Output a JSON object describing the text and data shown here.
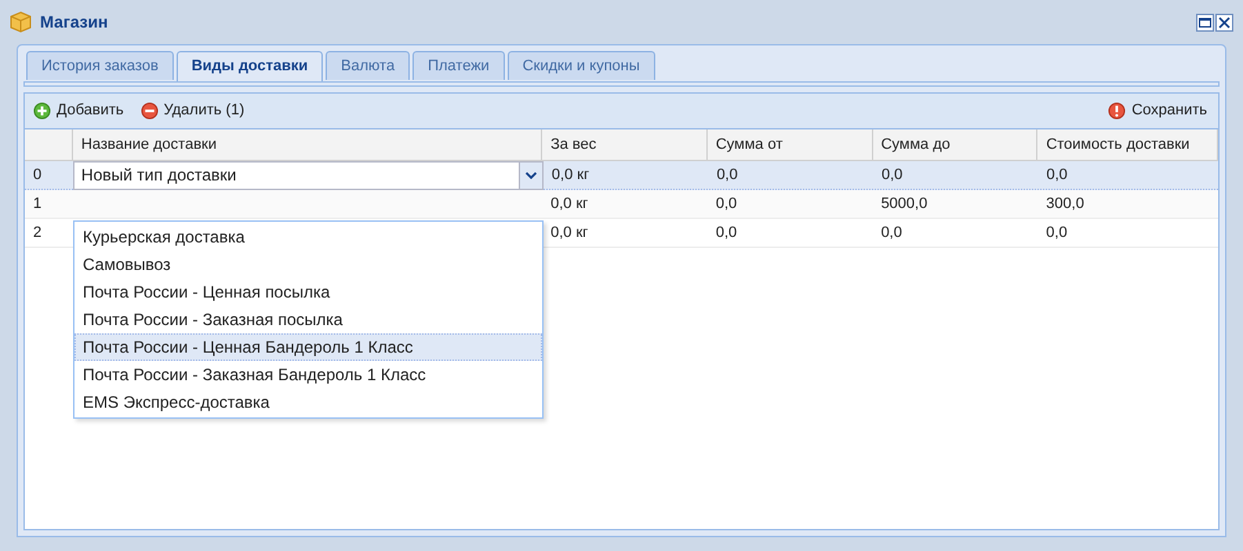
{
  "window": {
    "title": "Магазин"
  },
  "tabs": [
    {
      "label": "История заказов",
      "selected": false
    },
    {
      "label": "Виды доставки",
      "selected": true
    },
    {
      "label": "Валюта",
      "selected": false
    },
    {
      "label": "Платежи",
      "selected": false
    },
    {
      "label": "Скидки и купоны",
      "selected": false
    }
  ],
  "toolbar": {
    "add": "Добавить",
    "delete": "Удалить (1)",
    "save": "Сохранить"
  },
  "table": {
    "columns": [
      "Название доставки",
      "За вес",
      "Сумма от",
      "Сумма до",
      "Стоимость доставки"
    ],
    "rows": [
      {
        "number": "0",
        "selected": true,
        "editing": true,
        "cells": [
          "Новый тип доставки",
          "0,0 кг",
          "0,0",
          "0,0",
          "0,0"
        ]
      },
      {
        "number": "1",
        "selected": false,
        "editing": false,
        "cells": [
          "",
          "0,0 кг",
          "0,0",
          "5000,0",
          "300,0"
        ]
      },
      {
        "number": "2",
        "selected": false,
        "editing": false,
        "cells": [
          "",
          "0,0 кг",
          "0,0",
          "0,0",
          "0,0"
        ]
      }
    ]
  },
  "dropdown": {
    "options": [
      {
        "label": "Курьерская доставка",
        "selected": false
      },
      {
        "label": "Самовывоз",
        "selected": false
      },
      {
        "label": "Почта России - Ценная посылка",
        "selected": false
      },
      {
        "label": "Почта России - Заказная посылка",
        "selected": false
      },
      {
        "label": "Почта России - Ценная Бандероль 1 Класс",
        "selected": true
      },
      {
        "label": "Почта России - Заказная Бандероль 1 Класс",
        "selected": false
      },
      {
        "label": "EMS Экспресс-доставка",
        "selected": false
      }
    ]
  }
}
